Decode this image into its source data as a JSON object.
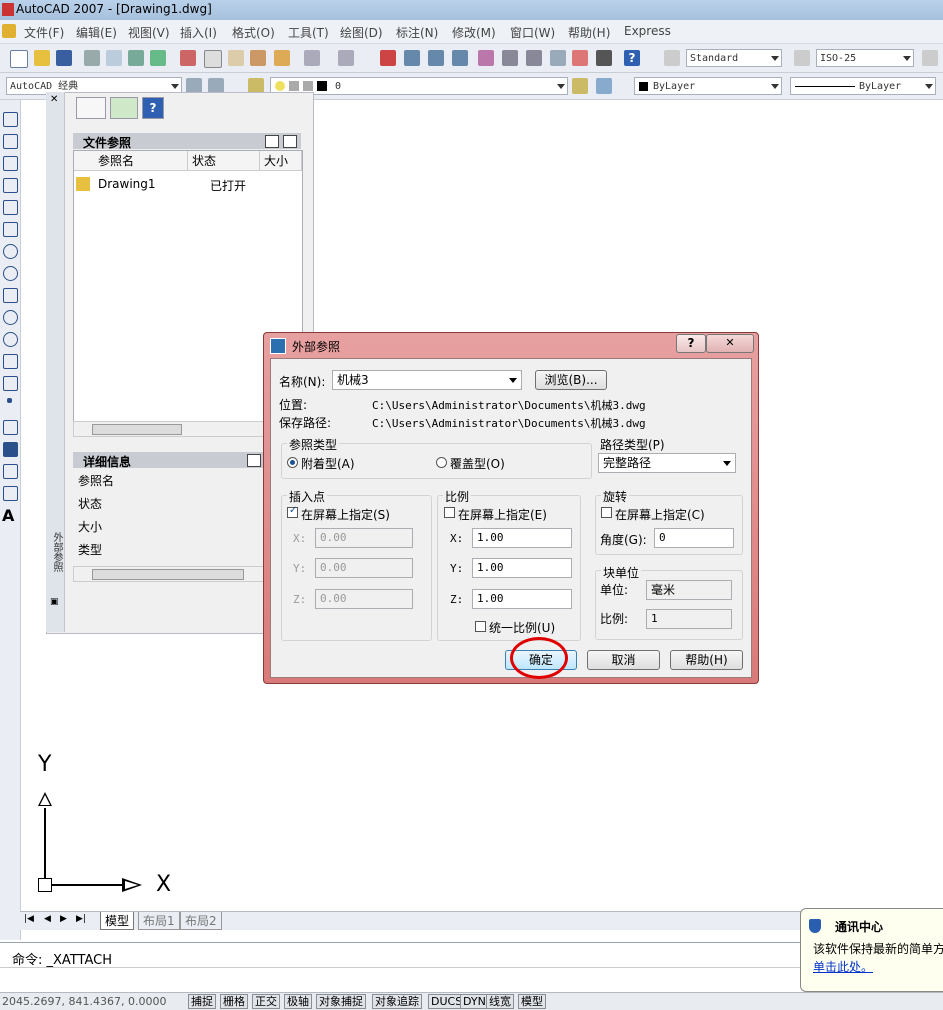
{
  "window": {
    "title": "AutoCAD 2007 - [Drawing1.dwg]"
  },
  "menu": [
    "文件(F)",
    "编辑(E)",
    "视图(V)",
    "插入(I)",
    "格式(O)",
    "工具(T)",
    "绘图(D)",
    "标注(N)",
    "修改(M)",
    "窗口(W)",
    "帮助(H)",
    "Express"
  ],
  "toolbar": {
    "text_style": "Standard",
    "dim_style": "ISO-25",
    "workspace": "AutoCAD 经典",
    "layer": "0",
    "color": "ByLayer",
    "linetype": "ByLayer"
  },
  "palette": {
    "side_title": "外部参照",
    "file_refs_header": "文件参照",
    "columns": [
      "参照名",
      "状态",
      "大小"
    ],
    "rows": [
      {
        "name": "Drawing1",
        "status": "已打开",
        "size": ""
      }
    ],
    "details_header": "详细信息",
    "details": [
      "参照名",
      "状态",
      "大小",
      "类型"
    ]
  },
  "dialog": {
    "title": "外部参照",
    "name_label": "名称(N):",
    "name_value": "机械3",
    "browse": "浏览(B)...",
    "location_label": "位置:",
    "location_value": "C:\\Users\\Administrator\\Documents\\机械3.dwg",
    "savepath_label": "保存路径:",
    "savepath_value": "C:\\Users\\Administrator\\Documents\\机械3.dwg",
    "ref_type_label": "参照类型",
    "attach": "附着型(A)",
    "overlay": "覆盖型(O)",
    "path_type_label": "路径类型(P)",
    "path_type_value": "完整路径",
    "insert_label": "插入点",
    "specify_screen_s": "在屏幕上指定(S)",
    "ins_x": "0.00",
    "ins_y": "0.00",
    "ins_z": "0.00",
    "scale_label": "比例",
    "specify_screen_e": "在屏幕上指定(E)",
    "scale_x": "1.00",
    "scale_y": "1.00",
    "scale_z": "1.00",
    "uniform": "统一比例(U)",
    "rotation_label": "旋转",
    "specify_screen_c": "在屏幕上指定(C)",
    "angle_label": "角度(G):",
    "angle_value": "0",
    "block_unit_label": "块单位",
    "unit_label": "单位:",
    "unit_value": "毫米",
    "ratio_label": "比例:",
    "ratio_value": "1",
    "x": "X:",
    "y": "Y:",
    "z": "Z:",
    "ok": "确定",
    "cancel": "取消",
    "help": "帮助(H)",
    "help_glyph": "?",
    "close_glyph": "✕"
  },
  "axes": {
    "y": "Y",
    "x": "X"
  },
  "tabs": [
    "模型",
    "布局1",
    "布局2"
  ],
  "command": "命令: _XATTACH",
  "status": {
    "coords": "2045.2697, 841.4367, 0.0000",
    "buttons": [
      "捕捉",
      "栅格",
      "正交",
      "极轴",
      "对象捕捉",
      "对象追踪",
      "DUCS",
      "DYN",
      "线宽",
      "模型"
    ]
  },
  "bubble": {
    "title": "通讯中心",
    "text": "该软件保持最新的简单方",
    "link": "单击此处。"
  },
  "colors": {
    "dialog_frame": "#d98080",
    "highlight_circle": "#e00000"
  }
}
